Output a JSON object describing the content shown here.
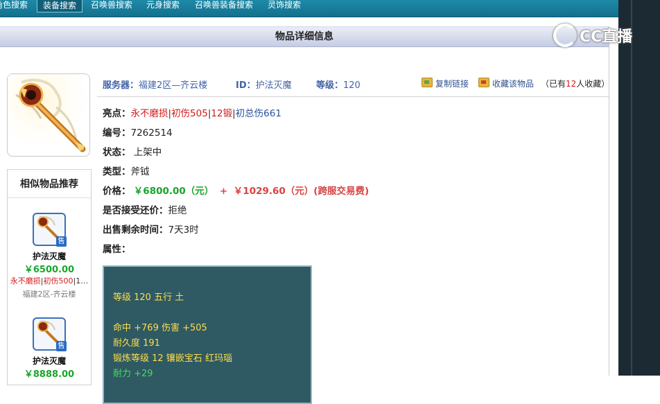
{
  "nav": {
    "tabs": [
      {
        "label": "角色搜索",
        "active": false
      },
      {
        "label": "装备搜索",
        "active": true
      },
      {
        "label": "召唤兽搜索",
        "active": false
      },
      {
        "label": "元身搜索",
        "active": false
      },
      {
        "label": "召唤兽装备搜索",
        "active": false
      },
      {
        "label": "灵饰搜索",
        "active": false
      }
    ]
  },
  "watermark": {
    "text": "CC直播"
  },
  "page": {
    "title": "物品详细信息"
  },
  "info": {
    "server_label": "服务器：",
    "server_value": "福建2区—齐云楼",
    "id_label": "ID：",
    "id_value": "护法灭魔",
    "level_label": "等级：",
    "level_value": "120",
    "copy_link": "复制链接",
    "favorite": "收藏该物品",
    "fav_prefix": "（已有",
    "fav_count": "12",
    "fav_suffix": "人收藏）"
  },
  "details": {
    "highlight_label": "亮点：",
    "highlights": [
      "永不磨损",
      "初伤505",
      "12锻",
      "初总伤661"
    ],
    "sep": "|",
    "number_label": "编号：",
    "number_value": "7262514",
    "status_label": "状态：",
    "status_value": "上架中",
    "type_label": "类型：",
    "type_value": "斧钺",
    "price_label": "价格：",
    "price_value": "￥6800.00（元）",
    "price_plus": "+",
    "fee_value": "￥1029.60（元）(跨服交易费)",
    "counter_label": "是否接受还价：",
    "counter_value": "拒绝",
    "time_label": "出售剩余时间：",
    "time_value": "7天3时",
    "attr_label": "属性："
  },
  "attributes": {
    "line1": "等级 120  五行 土",
    "line2": "命中 +769 伤害 +505",
    "line3": "耐久度 191",
    "line4": "锻炼等级 12  镶嵌宝石 红玛瑙",
    "line5": "耐力 +29"
  },
  "similar": {
    "title": "相似物品推荐",
    "sold_badge": "售",
    "items": [
      {
        "name": "护法灭魔",
        "price": "￥6500.00",
        "tags": [
          "永不磨损",
          "初伤500",
          "1…"
        ],
        "server": "福建2区-齐云楼"
      },
      {
        "name": "护法灭魔",
        "price": "￥8888.00"
      }
    ]
  },
  "colors": {
    "nav_bg": "#1586a5",
    "header_bg": "#c6cde4",
    "attr_bg": "#2f5a63",
    "price_green": "#19a62b",
    "highlight_red": "#d21919",
    "label_blue": "#4063a8"
  }
}
